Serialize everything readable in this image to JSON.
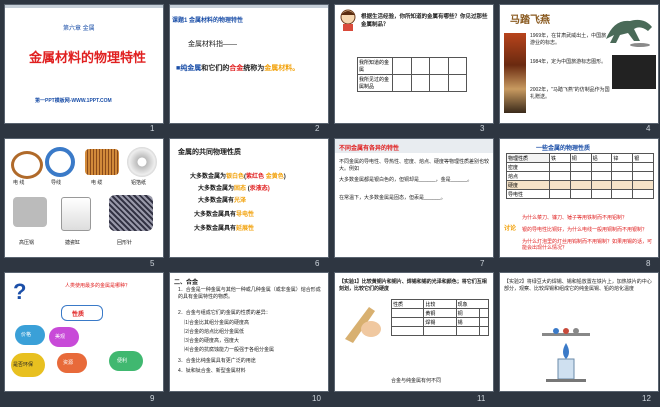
{
  "slides": [
    {
      "num": "1",
      "chapter": "第六章 金属",
      "title": "金属材料的物理特性",
      "footer": "第一PPT模板网-WWW.1PPT.COM"
    },
    {
      "num": "2",
      "heading": "课题1 金属材料的物理特性",
      "subheading": "金属材料指——",
      "line1_a": "纯金属",
      "line1_b": "和它们的",
      "line1_c": "合金",
      "line1_d": "统称为",
      "line1_e": "金属材料。"
    },
    {
      "num": "3",
      "question": "根据生活经验，你所知道的金属有哪些？你见过那些金属制品？",
      "row1": "我所知道的金属",
      "row2": "我所见过的金属制品"
    },
    {
      "num": "4",
      "title": "马踏飞燕",
      "bullet1": "1969年，在甘肃武威出土，中国旅游业的标志。",
      "bullet2": "1984年，定为中国旅游标志图形。",
      "bullet3": "2002年，\"马踏飞燕\"的仿制品作为国礼赠送。"
    },
    {
      "num": "5",
      "captions": [
        "电 线",
        "导线",
        "电 缆",
        "铝箔纸",
        "高压锅",
        "搪瓷缸",
        "回形针"
      ]
    },
    {
      "num": "6",
      "title": "金属的共同物理性质",
      "l1": "大多数金属为",
      "l1a": "银白色",
      "l1b": "(",
      "l1c": "紫红色",
      "l1d": "金黄色",
      "l1e": ")",
      "l2": "大多数金属为",
      "l2a": "固态",
      "l2b": "(",
      "l2c": "汞",
      "l2d": "液态)",
      "l3": "大多数金属有",
      "l3a": "光泽",
      "l4": "大多数金属具有",
      "l4a": "导电性",
      "l5": "大多数金属具有",
      "l5a": "延展性"
    },
    {
      "num": "7",
      "title": "不同金属有各异的特性",
      "b1": "不同金属的导电性、导热性、密度、熔点、硬度等物理性质差别也较大。例如",
      "b2": "大多数金属都是银白色的，但铜却是______，金是______。",
      "b3": "在常温下，大多数金属是固态，但汞是______。"
    },
    {
      "num": "8",
      "title": "一些金属的物理性质",
      "rows": [
        "物理性质",
        "密度",
        "熔点",
        "硬度",
        "导电性"
      ],
      "q1": "为什么菜刀、镰刀、锤子等用铁制而不用铝制？",
      "q2": "银的导电性比铜好，为什么电线一般用铜制而不用银制？",
      "q3": "为什么灯泡里的灯丝用钨制而不用锡制？如果用锡的话，可能会出现什么情况？",
      "discuss": "讨论"
    },
    {
      "num": "9",
      "q": "人类使用最多的金属是哪种？",
      "s": "性质",
      "t1": "价格",
      "t2": "美观",
      "t3": "是否环保",
      "t4": "资源",
      "t5": "便利"
    },
    {
      "num": "10",
      "section": "二、合金",
      "def": "1．合金是一种金属与其他一种或几种金属（或非金属）熔合形成的具有金属特性的物质。",
      "i2": "2．合金与组成它们的金属的性质的差异：",
      "a": "⑴合金比其组分金属的硬度高",
      "b": "⑵合金的熔点比组分金属低",
      "c": "⑶合金的硬度高，强度大",
      "d": "⑷合金的抗腐蚀能力一般强于各组分金属",
      "i3": "3．合金比纯金属具有更广泛的用途",
      "i4": "4．钛和钛合金、新型金属材料"
    },
    {
      "num": "11",
      "title": "【实验1】比较黄铜片和铜片、焊锡和锡的光泽和颜色；将它们互相刻划，比较它们的硬度",
      "h1": "性质",
      "h2": "比较",
      "h3": "现象",
      "c1": "黄铜",
      "c2": "铜",
      "c3": "焊锡",
      "c4": "锡",
      "note": "合金与纯金属有何不同"
    },
    {
      "num": "12",
      "title": "【实验2】将绿豆大的焊锡、锡和铅放置在铁片上，加热铁片的中心部分，观察、比较焊锡和组成它的纯金属锡、铅的熔化温度"
    }
  ],
  "colors": {
    "background": "#2e3641",
    "accent_red": "#e02020",
    "accent_blue": "#1b4fa8",
    "accent_orange": "#f2a20c"
  }
}
